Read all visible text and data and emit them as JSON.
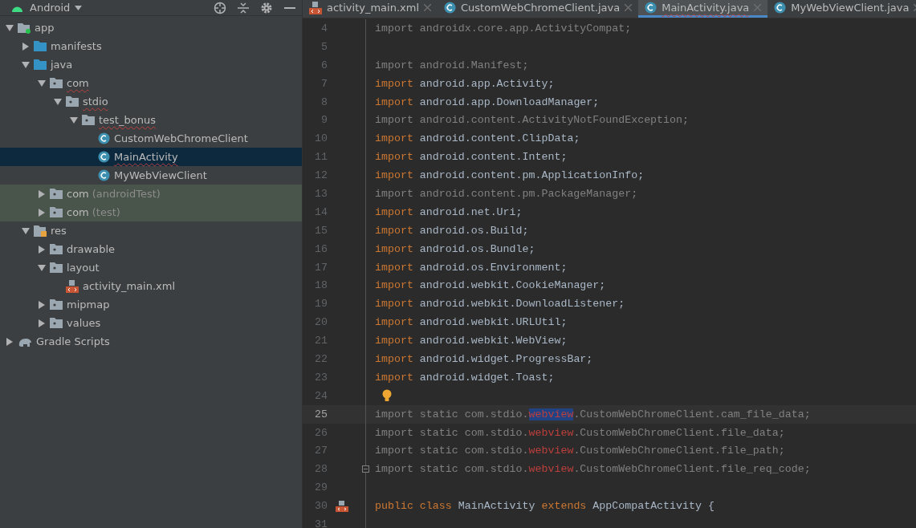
{
  "project_panel": {
    "view_selector": "Android",
    "tree": [
      {
        "label": "app",
        "kind": "module",
        "expanded": true,
        "selected": false,
        "misspelled": false,
        "children": [
          {
            "label": "manifests",
            "kind": "source_folder",
            "expanded": false,
            "selected": false,
            "misspelled": false
          },
          {
            "label": "java",
            "kind": "source_folder",
            "expanded": true,
            "selected": false,
            "misspelled": false,
            "children": [
              {
                "label": "com",
                "kind": "package",
                "expanded": true,
                "selected": false,
                "misspelled": true,
                "children": [
                  {
                    "label": "stdio",
                    "kind": "package",
                    "expanded": true,
                    "selected": false,
                    "misspelled": true,
                    "children": [
                      {
                        "label": "test_bonus",
                        "kind": "package",
                        "expanded": true,
                        "selected": false,
                        "misspelled": true,
                        "children": [
                          {
                            "label": "CustomWebChromeClient",
                            "kind": "class",
                            "selected": false,
                            "misspelled": false
                          },
                          {
                            "label": "MainActivity",
                            "kind": "class",
                            "selected": true,
                            "misspelled": true
                          },
                          {
                            "label": "MyWebViewClient",
                            "kind": "class",
                            "selected": false,
                            "misspelled": false
                          }
                        ]
                      }
                    ]
                  }
                ]
              },
              {
                "label": "com",
                "suffix": "(androidTest)",
                "test_scope": true,
                "kind": "package",
                "expanded": false,
                "selected": false,
                "misspelled": false
              },
              {
                "label": "com",
                "suffix": "(test)",
                "test_scope": true,
                "kind": "package",
                "expanded": false,
                "selected": false,
                "misspelled": false
              }
            ]
          },
          {
            "label": "res",
            "kind": "res_folder",
            "expanded": true,
            "selected": false,
            "misspelled": false,
            "children": [
              {
                "label": "drawable",
                "kind": "package",
                "expanded": false,
                "selected": false,
                "misspelled": false
              },
              {
                "label": "layout",
                "kind": "package",
                "expanded": true,
                "selected": false,
                "misspelled": false,
                "children": [
                  {
                    "label": "activity_main.xml",
                    "kind": "xml",
                    "selected": false,
                    "misspelled": false
                  }
                ]
              },
              {
                "label": "mipmap",
                "kind": "package",
                "expanded": false,
                "selected": false,
                "misspelled": false
              },
              {
                "label": "values",
                "kind": "package",
                "expanded": false,
                "selected": false,
                "misspelled": false
              }
            ]
          }
        ]
      },
      {
        "label": "Gradle Scripts",
        "kind": "gradle",
        "expanded": false,
        "selected": false,
        "misspelled": false
      }
    ]
  },
  "editor": {
    "tabs": [
      {
        "label": "activity_main.xml",
        "kind": "xml",
        "selected": false,
        "misspelled": false
      },
      {
        "label": "CustomWebChromeClient.java",
        "kind": "class",
        "selected": false,
        "misspelled": false
      },
      {
        "label": "MainActivity.java",
        "kind": "class",
        "selected": true,
        "misspelled": true
      },
      {
        "label": "MyWebViewClient.java",
        "kind": "class",
        "selected": false,
        "misspelled": false
      }
    ],
    "lines": [
      {
        "number": "4",
        "kind": "code",
        "current": false,
        "tokens": [
          {
            "kind": "unused",
            "text": "import androidx.core.app.ActivityCompat;"
          }
        ]
      },
      {
        "number": "5",
        "kind": "empty",
        "current": false
      },
      {
        "number": "6",
        "kind": "code",
        "current": false,
        "tokens": [
          {
            "kind": "unused",
            "text": "import android.Manifest;"
          }
        ]
      },
      {
        "number": "7",
        "kind": "code",
        "current": false,
        "tokens": [
          {
            "kind": "keyword",
            "text": "import"
          },
          {
            "kind": "plain",
            "text": " android.app.Activity;"
          }
        ]
      },
      {
        "number": "8",
        "kind": "code",
        "current": false,
        "tokens": [
          {
            "kind": "keyword",
            "text": "import"
          },
          {
            "kind": "plain",
            "text": " android.app.DownloadManager;"
          }
        ]
      },
      {
        "number": "9",
        "kind": "code",
        "current": false,
        "tokens": [
          {
            "kind": "unused",
            "text": "import android.content.ActivityNotFoundException;"
          }
        ]
      },
      {
        "number": "10",
        "kind": "code",
        "current": false,
        "tokens": [
          {
            "kind": "keyword",
            "text": "import"
          },
          {
            "kind": "plain",
            "text": " android.content.ClipData;"
          }
        ]
      },
      {
        "number": "11",
        "kind": "code",
        "current": false,
        "tokens": [
          {
            "kind": "keyword",
            "text": "import"
          },
          {
            "kind": "plain",
            "text": " android.content.Intent;"
          }
        ]
      },
      {
        "number": "12",
        "kind": "code",
        "current": false,
        "tokens": [
          {
            "kind": "keyword",
            "text": "import"
          },
          {
            "kind": "plain",
            "text": " android.content.pm.ApplicationInfo;"
          }
        ]
      },
      {
        "number": "13",
        "kind": "code",
        "current": false,
        "tokens": [
          {
            "kind": "unused",
            "text": "import android.content.pm.PackageManager;"
          }
        ]
      },
      {
        "number": "14",
        "kind": "code",
        "current": false,
        "tokens": [
          {
            "kind": "keyword",
            "text": "import"
          },
          {
            "kind": "plain",
            "text": " android.net.Uri;"
          }
        ]
      },
      {
        "number": "15",
        "kind": "code",
        "current": false,
        "tokens": [
          {
            "kind": "keyword",
            "text": "import"
          },
          {
            "kind": "plain",
            "text": " android.os.Build;"
          }
        ]
      },
      {
        "number": "16",
        "kind": "code",
        "current": false,
        "tokens": [
          {
            "kind": "keyword",
            "text": "import"
          },
          {
            "kind": "plain",
            "text": " android.os.Bundle;"
          }
        ]
      },
      {
        "number": "17",
        "kind": "code",
        "current": false,
        "tokens": [
          {
            "kind": "keyword",
            "text": "import"
          },
          {
            "kind": "plain",
            "text": " android.os.Environment;"
          }
        ]
      },
      {
        "number": "18",
        "kind": "code",
        "current": false,
        "tokens": [
          {
            "kind": "keyword",
            "text": "import"
          },
          {
            "kind": "plain",
            "text": " android.webkit.CookieManager;"
          }
        ]
      },
      {
        "number": "19",
        "kind": "code",
        "current": false,
        "tokens": [
          {
            "kind": "keyword",
            "text": "import"
          },
          {
            "kind": "plain",
            "text": " android.webkit.DownloadListener;"
          }
        ]
      },
      {
        "number": "20",
        "kind": "code",
        "current": false,
        "tokens": [
          {
            "kind": "keyword",
            "text": "import"
          },
          {
            "kind": "plain",
            "text": " android.webkit.URLUtil;"
          }
        ]
      },
      {
        "number": "21",
        "kind": "code",
        "current": false,
        "tokens": [
          {
            "kind": "keyword",
            "text": "import"
          },
          {
            "kind": "plain",
            "text": " android.webkit.WebView;"
          }
        ]
      },
      {
        "number": "22",
        "kind": "code",
        "current": false,
        "tokens": [
          {
            "kind": "keyword",
            "text": "import"
          },
          {
            "kind": "plain",
            "text": " android.widget.ProgressBar;"
          }
        ]
      },
      {
        "number": "23",
        "kind": "code",
        "current": false,
        "tokens": [
          {
            "kind": "keyword",
            "text": "import"
          },
          {
            "kind": "plain",
            "text": " android.widget.Toast;"
          }
        ]
      },
      {
        "number": "24",
        "kind": "hint",
        "current": false
      },
      {
        "number": "25",
        "kind": "code",
        "current": true,
        "tokens": [
          {
            "kind": "unused",
            "text": "import static com.stdio."
          },
          {
            "kind": "error",
            "text": "webview",
            "highlighted": true
          },
          {
            "kind": "unused",
            "text": ".CustomWebChromeClient.cam_file_data;"
          }
        ]
      },
      {
        "number": "26",
        "kind": "code",
        "current": false,
        "tokens": [
          {
            "kind": "unused",
            "text": "import static com.stdio."
          },
          {
            "kind": "error",
            "text": "webview",
            "highlighted": false
          },
          {
            "kind": "unused",
            "text": ".CustomWebChromeClient.file_data;"
          }
        ]
      },
      {
        "number": "27",
        "kind": "code",
        "current": false,
        "tokens": [
          {
            "kind": "unused",
            "text": "import static com.stdio."
          },
          {
            "kind": "error",
            "text": "webview",
            "highlighted": false
          },
          {
            "kind": "unused",
            "text": ".CustomWebChromeClient.file_path;"
          }
        ]
      },
      {
        "number": "28",
        "kind": "fold_start",
        "current": false,
        "tokens": [
          {
            "kind": "unused",
            "text": "import static com.stdio."
          },
          {
            "kind": "error",
            "text": "webview",
            "highlighted": false
          },
          {
            "kind": "unused",
            "text": ".CustomWebChromeClient.file_req_code;"
          }
        ]
      },
      {
        "number": "29",
        "kind": "empty",
        "current": false
      },
      {
        "number": "30",
        "kind": "class_header",
        "current": false,
        "tokens": [
          {
            "kind": "keyword",
            "text": "public class"
          },
          {
            "kind": "plain",
            "text": " MainActivity "
          },
          {
            "kind": "keyword",
            "text": "extends"
          },
          {
            "kind": "plain",
            "text": " AppCompatActivity {"
          }
        ]
      },
      {
        "number": "31",
        "kind": "empty",
        "current": false
      }
    ]
  }
}
